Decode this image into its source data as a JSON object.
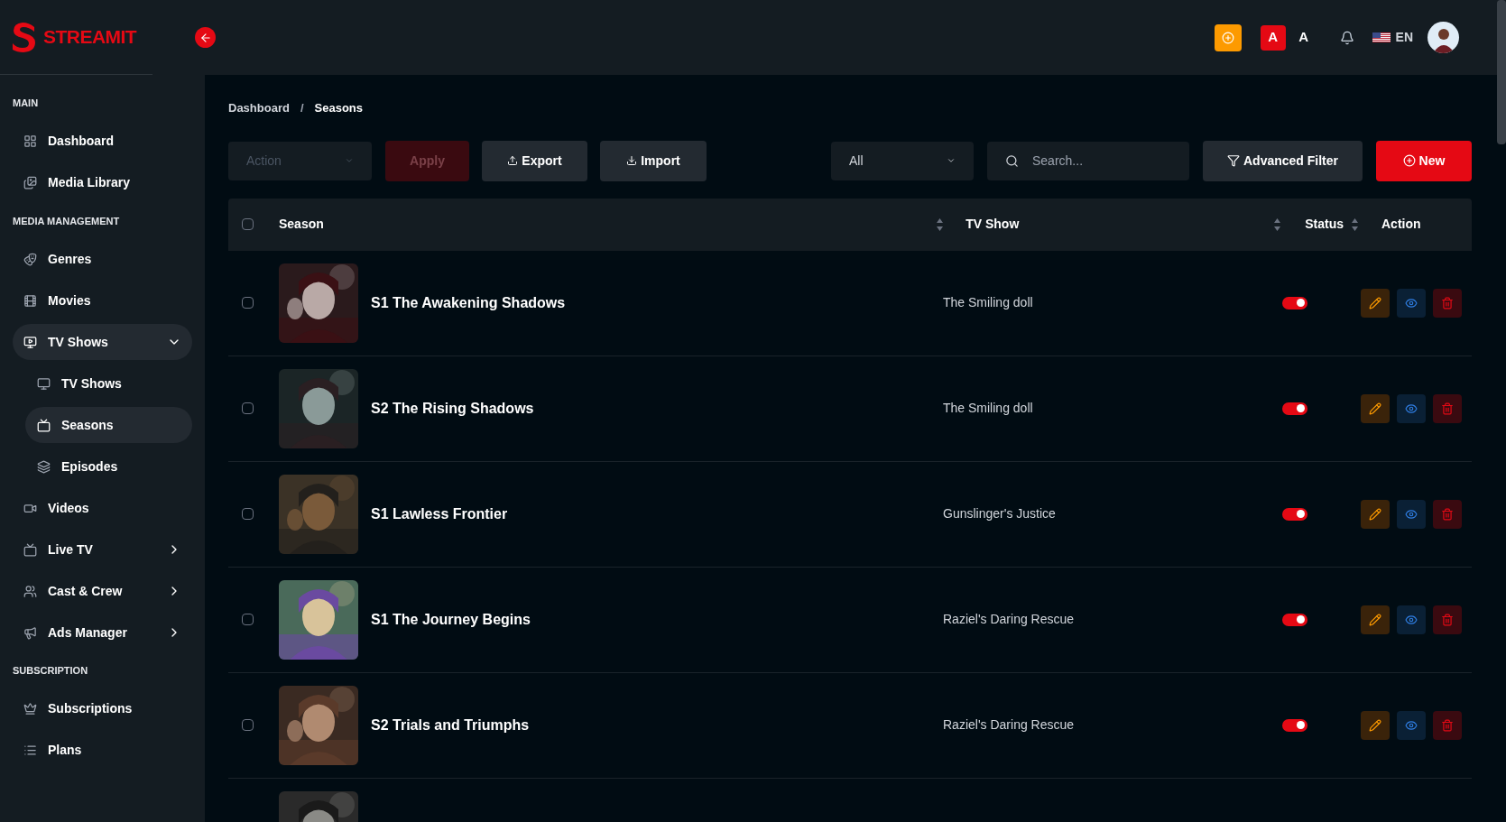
{
  "brand": {
    "name": "STREAMIT"
  },
  "header": {
    "language": "EN",
    "font_buttons": [
      {
        "label": "A",
        "selected": true
      },
      {
        "label": "A",
        "selected": false
      }
    ]
  },
  "sidebar": {
    "sections": [
      {
        "title": "MAIN",
        "items": [
          {
            "label": "Dashboard",
            "selected": false
          },
          {
            "label": "Media Library",
            "selected": false
          }
        ]
      },
      {
        "title": "MEDIA MANAGEMENT",
        "items": [
          {
            "label": "Genres",
            "selected": false
          },
          {
            "label": "Movies",
            "selected": false
          },
          {
            "label": "TV Shows",
            "selected": true,
            "expanded": true,
            "children": [
              {
                "label": "TV Shows",
                "selected": false
              },
              {
                "label": "Seasons",
                "selected": true
              },
              {
                "label": "Episodes",
                "selected": false
              }
            ]
          },
          {
            "label": "Videos",
            "selected": false
          },
          {
            "label": "Live TV",
            "selected": false,
            "expanded": false
          },
          {
            "label": "Cast & Crew",
            "selected": false,
            "expanded": false
          },
          {
            "label": "Ads Manager",
            "selected": false,
            "expanded": false
          }
        ]
      },
      {
        "title": "SUBSCRIPTION",
        "items": [
          {
            "label": "Subscriptions",
            "selected": false
          },
          {
            "label": "Plans",
            "selected": false
          }
        ]
      }
    ]
  },
  "breadcrumb": [
    "Dashboard",
    "/",
    "Seasons"
  ],
  "toolbar": {
    "action_placeholder": "Action",
    "apply": "Apply",
    "apply_disabled": true,
    "export": "Export",
    "import": "Import",
    "filter_value": "All",
    "search_placeholder": "Search...",
    "advanced_filter": "Advanced Filter",
    "new": "New"
  },
  "table": {
    "select_all_checked": false,
    "columns": [
      "Season",
      "TV Show",
      "Status",
      "Action"
    ],
    "rows": [
      {
        "season": "S1 The Awakening Shadows",
        "tv_show": "The Smiling doll",
        "checked": false,
        "on": true
      },
      {
        "season": "S2 The Rising Shadows",
        "tv_show": "The Smiling doll",
        "checked": false,
        "on": true
      },
      {
        "season": "S1 Lawless Frontier",
        "tv_show": "Gunslinger's Justice",
        "checked": false,
        "on": true
      },
      {
        "season": "S1 The Journey Begins",
        "tv_show": "Raziel's Daring Rescue",
        "checked": false,
        "on": true
      },
      {
        "season": "S2 Trials and Triumphs",
        "tv_show": "Raziel's Daring Rescue",
        "checked": false,
        "on": true
      },
      {
        "kind": "picture"
      }
    ]
  }
}
